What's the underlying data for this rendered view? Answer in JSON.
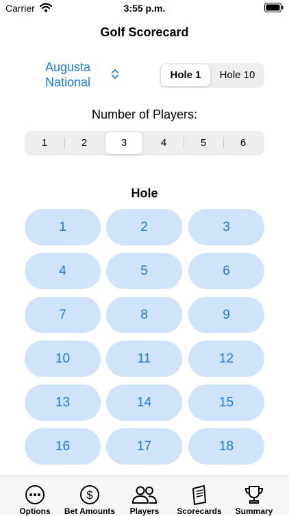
{
  "status_bar": {
    "carrier": "Carrier",
    "time": "3:55 p.m."
  },
  "header": {
    "title": "Golf Scorecard"
  },
  "course": {
    "name": "Augusta National"
  },
  "start_hole": {
    "options": [
      "Hole 1",
      "Hole 10"
    ],
    "selected": "Hole 1"
  },
  "players": {
    "label": "Number of Players:",
    "options": [
      "1",
      "2",
      "3",
      "4",
      "5",
      "6"
    ],
    "selected": "3"
  },
  "holes": {
    "heading": "Hole",
    "numbers": [
      "1",
      "2",
      "3",
      "4",
      "5",
      "6",
      "7",
      "8",
      "9",
      "10",
      "11",
      "12",
      "13",
      "14",
      "15",
      "16",
      "17",
      "18"
    ]
  },
  "tab_bar": {
    "items": [
      {
        "label": "Options",
        "icon": "ellipsis-circle-icon"
      },
      {
        "label": "Bet Amounts",
        "icon": "dollar-circle-icon"
      },
      {
        "label": "Players",
        "icon": "people-icon"
      },
      {
        "label": "Scorecards",
        "icon": "book-icon"
      },
      {
        "label": "Summary",
        "icon": "trophy-icon"
      }
    ]
  },
  "colors": {
    "accent": "#1a7ae8",
    "hole_button_bg": "#cfe3fa",
    "segment_bg": "#eeeef0"
  }
}
